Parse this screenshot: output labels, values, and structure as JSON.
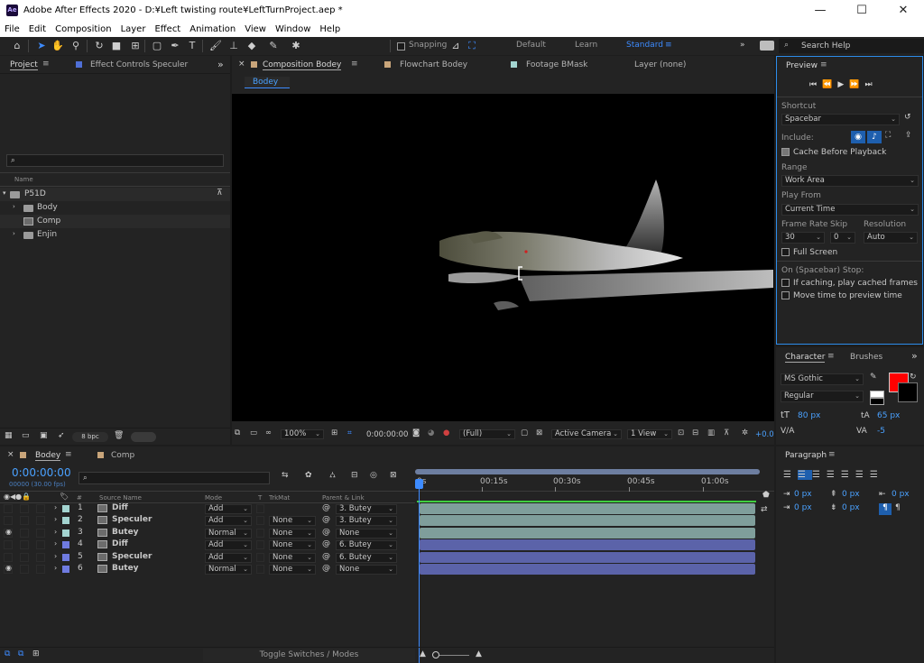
{
  "window": {
    "title": "Adobe After Effects 2020 - D:¥Left twisting route¥LeftTurnProject.aep *",
    "app_icon": "Ae",
    "minimize": "—",
    "maximize": "☐",
    "close": "✕"
  },
  "menu": [
    "File",
    "Edit",
    "Composition",
    "Layer",
    "Effect",
    "Animation",
    "View",
    "Window",
    "Help"
  ],
  "toolbar": {
    "snapping": "Snapping",
    "workspaces": [
      "Default",
      "Learn",
      "Standard"
    ],
    "active_workspace": "Standard",
    "search_placeholder": "Search Help"
  },
  "project_panel": {
    "tabs": [
      "Project",
      "Effect Controls Speculer"
    ],
    "search_placeholder": "",
    "column_name": "Name",
    "items": [
      {
        "label": "P51D",
        "type": "folder",
        "indent": 0
      },
      {
        "label": "Body",
        "type": "folder",
        "indent": 1
      },
      {
        "label": "Comp",
        "type": "comp",
        "indent": 1
      },
      {
        "label": "Enjin",
        "type": "folder",
        "indent": 1
      }
    ],
    "bpc": "8 bpc"
  },
  "comp_panel": {
    "tabs": [
      "Composition Bodey",
      "Flowchart Bodey",
      "Footage BMask",
      "Layer (none)"
    ],
    "breadcrumb": "Bodey",
    "zoom": "100%",
    "timecode": "0:00:00:00",
    "resolution": "(Full)",
    "camera": "Active Camera",
    "view": "1 View",
    "exposure": "+0.0"
  },
  "preview_panel": {
    "title": "Preview",
    "shortcut_label": "Shortcut",
    "shortcut_value": "Spacebar",
    "include_label": "Include:",
    "cache_label": "Cache Before Playback",
    "range_label": "Range",
    "range_value": "Work Area",
    "play_from_label": "Play From",
    "play_from_value": "Current Time",
    "frame_rate_label": "Frame Rate",
    "frame_rate_value": "30",
    "skip_label": "Skip",
    "skip_value": "0",
    "resolution_label": "Resolution",
    "resolution_value": "Auto",
    "full_screen_label": "Full Screen",
    "on_stop_label": "On (Spacebar) Stop:",
    "if_caching_label": "If caching, play cached frames",
    "move_time_label": "Move time to preview time"
  },
  "character_panel": {
    "tabs": [
      "Character",
      "Brushes"
    ],
    "font": "MS Gothic",
    "style": "Regular",
    "font_size": "80 px",
    "leading": "65 px",
    "kerning": "",
    "tracking": "-5",
    "fill_color": "#ff0000"
  },
  "paragraph_panel": {
    "title": "Paragraph",
    "indent_left": "0 px",
    "indent_right": "0 px",
    "indent_first": "0 px",
    "space_before": "0 px",
    "space_after": "0 px"
  },
  "timeline": {
    "tabs": [
      "Bodey",
      "Comp"
    ],
    "timecode": "0:00:00:00",
    "timecode_sub": "00000 (30.00 fps)",
    "columns": {
      "source": "Source Name",
      "mode": "Mode",
      "t": "T",
      "trkmat": "TrkMat",
      "parent": "Parent & Link"
    },
    "ruler": [
      "0s",
      "00:15s",
      "00:30s",
      "00:45s",
      "01:00s"
    ],
    "layers": [
      {
        "num": "1",
        "name": "Diff",
        "mode": "Add",
        "trkmat": "",
        "parent": "3. Butey",
        "color": "#a3d4d0",
        "eye": false
      },
      {
        "num": "2",
        "name": "Speculer",
        "mode": "Add",
        "trkmat": "None",
        "parent": "3. Butey",
        "color": "#a3d4d0",
        "eye": false
      },
      {
        "num": "3",
        "name": "Butey",
        "mode": "Normal",
        "trkmat": "None",
        "parent": "None",
        "color": "#a3d4d0",
        "eye": true
      },
      {
        "num": "4",
        "name": "Diff",
        "mode": "Add",
        "trkmat": "None",
        "parent": "6. Butey",
        "color": "#6f7be0",
        "eye": false
      },
      {
        "num": "5",
        "name": "Speculer",
        "mode": "Add",
        "trkmat": "None",
        "parent": "6. Butey",
        "color": "#6f7be0",
        "eye": false
      },
      {
        "num": "6",
        "name": "Butey",
        "mode": "Normal",
        "trkmat": "None",
        "parent": "None",
        "color": "#6f7be0",
        "eye": true
      }
    ],
    "toggle_label": "Toggle Switches / Modes"
  }
}
